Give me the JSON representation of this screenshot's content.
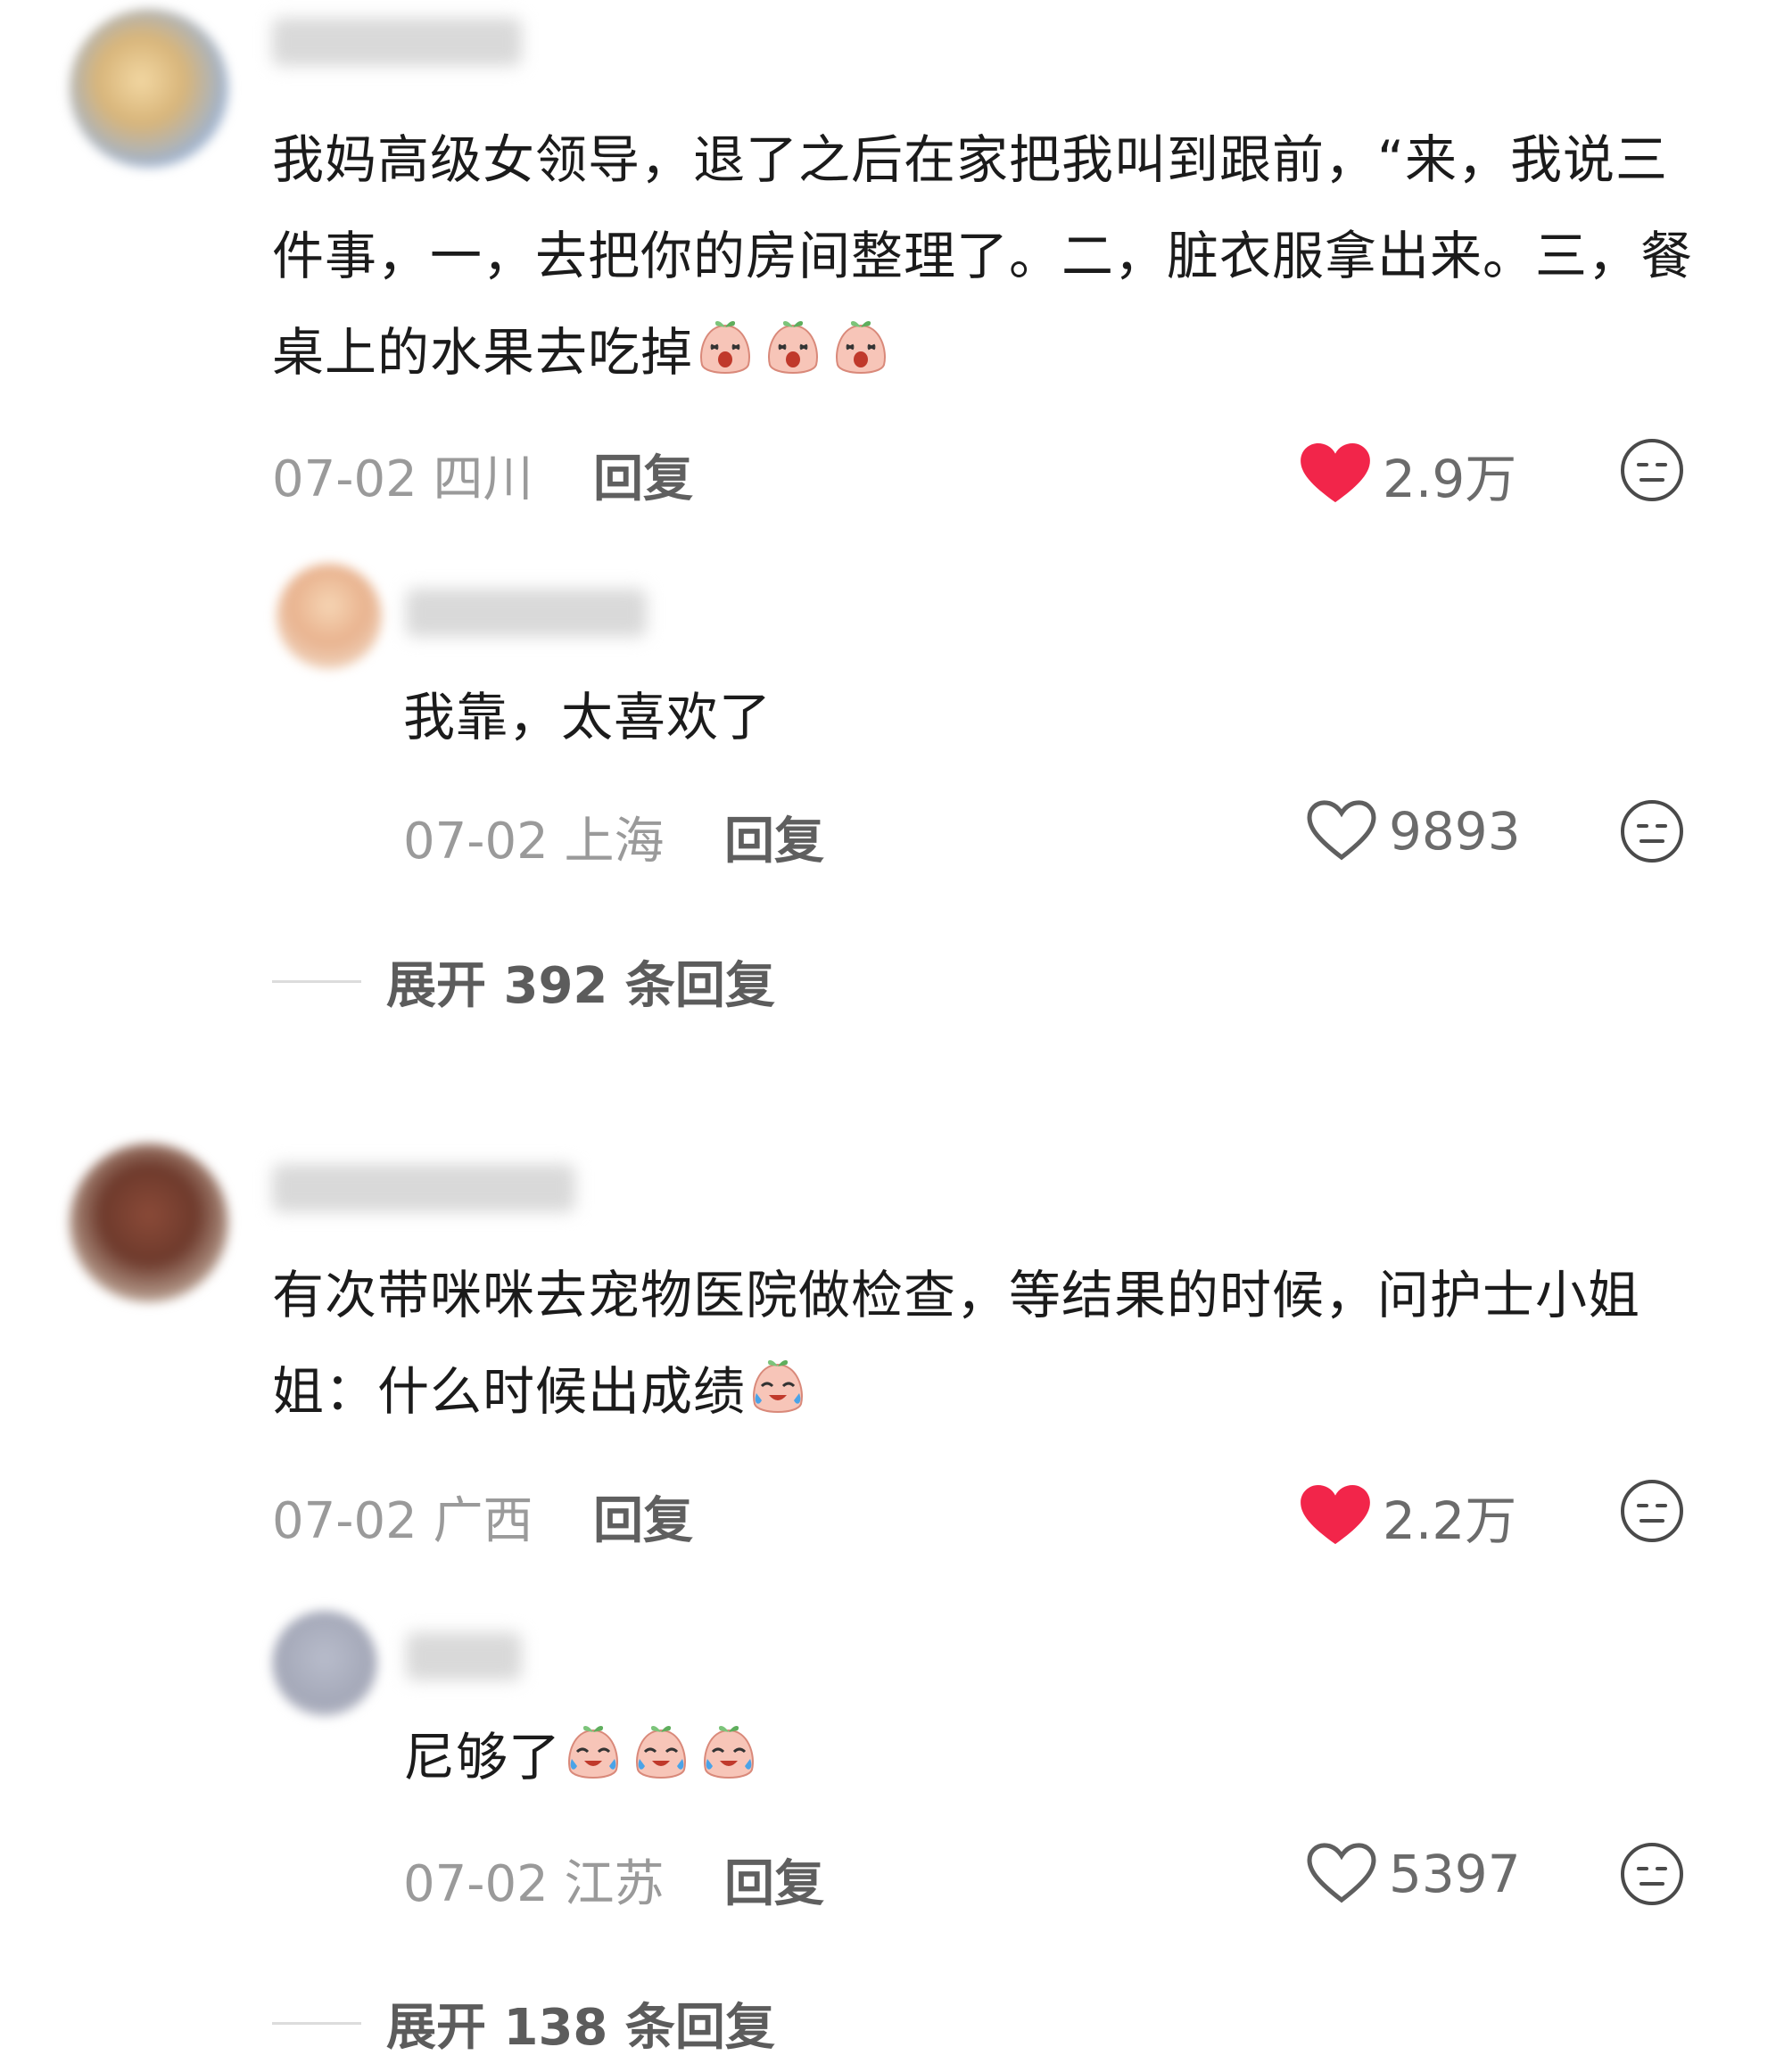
{
  "comments": [
    {
      "text": "我妈高级女领导，退了之后在家把我叫到跟前，“来，我说三件事，一，去把你的房间整理了。二，脏衣服拿出来。三，餐桌上的水果去吃掉",
      "text_emojis": [
        "shocked-peach-emoji",
        "shocked-peach-emoji",
        "shocked-peach-emoji"
      ],
      "date": "07-02",
      "location": "四川",
      "reply_label": "回复",
      "likes": "2.9万",
      "liked": true,
      "reply": {
        "text": "我靠，太喜欢了",
        "date": "07-02",
        "location": "上海",
        "reply_label": "回复",
        "likes": "9893",
        "liked": false
      },
      "expand_label": "展开 392 条回复"
    },
    {
      "text": "有次带咪咪去宠物医院做检查，等结果的时候，问护士小姐姐：什么时候出成绩",
      "text_emojis": [
        "crying-peach-emoji"
      ],
      "date": "07-02",
      "location": "广西",
      "reply_label": "回复",
      "likes": "2.2万",
      "liked": true,
      "reply": {
        "text": "尼够了",
        "text_emojis": [
          "crying-peach-emoji",
          "crying-peach-emoji",
          "crying-peach-emoji"
        ],
        "date": "07-02",
        "location": "江苏",
        "reply_label": "回复",
        "likes": "5397",
        "liked": false
      },
      "expand_label": "展开 138 条回复"
    }
  ],
  "colors": {
    "liked_heart": "#f2254a",
    "muted_text": "#9a9a9a",
    "body_text": "#1b1b1b"
  }
}
